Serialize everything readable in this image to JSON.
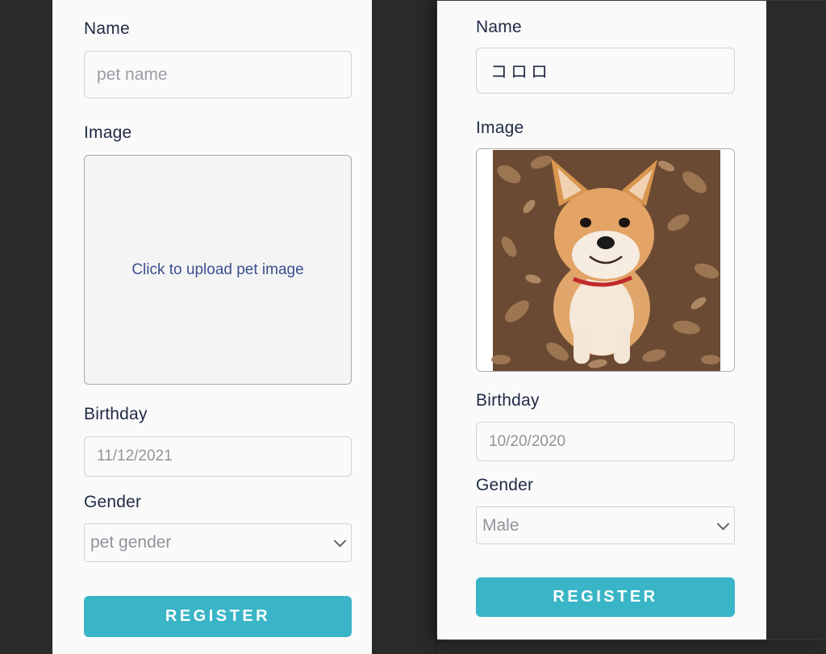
{
  "left_form": {
    "name_label": "Name",
    "name_placeholder": "pet name",
    "image_label": "Image",
    "upload_text": "Click to upload pet image",
    "birthday_label": "Birthday",
    "birthday_value": "11/12/2021",
    "gender_label": "Gender",
    "gender_value": "pet gender",
    "register_label": "REGISTER"
  },
  "right_form": {
    "name_label": "Name",
    "name_value": "コロロ",
    "image_label": "Image",
    "image_alt": "Shiba Inu dog sitting on fallen leaves",
    "birthday_label": "Birthday",
    "birthday_value": "10/20/2020",
    "gender_label": "Gender",
    "gender_value": "Male",
    "register_label": "REGISTER"
  },
  "colors": {
    "accent": "#3ab5c7",
    "label_text": "#1f2a44",
    "upload_link": "#3b4f8f",
    "background": "#2a2a2a"
  }
}
